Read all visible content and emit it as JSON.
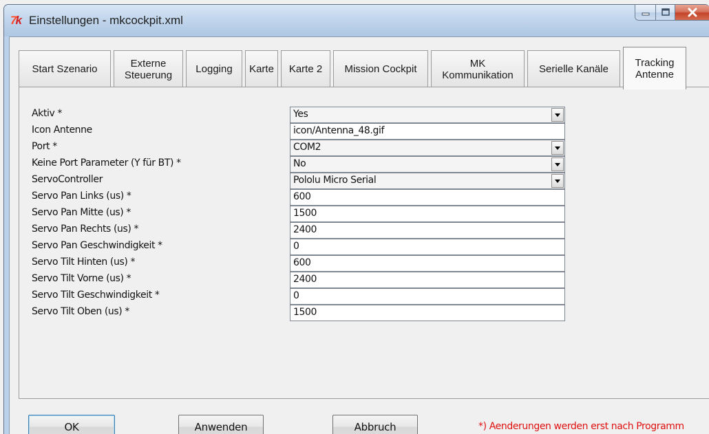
{
  "window": {
    "title": "Einstellungen - mkcockpit.xml",
    "icon": "mk-logo-icon",
    "caption_buttons": [
      "minimize-icon",
      "maximize-icon",
      "close-icon"
    ]
  },
  "tabs": [
    {
      "label": "Start Szenario",
      "active": false
    },
    {
      "label": "Externe\nSteuerung",
      "active": false
    },
    {
      "label": "Logging",
      "active": false
    },
    {
      "label": "Karte",
      "active": false
    },
    {
      "label": "Karte 2",
      "active": false
    },
    {
      "label": "Mission Cockpit",
      "active": false
    },
    {
      "label": "MK\nKommunikation",
      "active": false
    },
    {
      "label": "Serielle Kanäle",
      "active": false
    },
    {
      "label": "Tracking\nAntenne",
      "active": true
    }
  ],
  "settings": [
    {
      "label": "Aktiv *",
      "value": "Yes",
      "type": "combo"
    },
    {
      "label": "Icon Antenne",
      "value": "icon/Antenna_48.gif",
      "type": "text"
    },
    {
      "label": "Port *",
      "value": "COM2",
      "type": "combo"
    },
    {
      "label": "Keine Port Parameter (Y für BT) *",
      "value": "No",
      "type": "combo"
    },
    {
      "label": "ServoController",
      "value": "Pololu Micro Serial",
      "type": "combo"
    },
    {
      "label": "Servo Pan Links (us) *",
      "value": "600",
      "type": "text"
    },
    {
      "label": "Servo Pan Mitte (us) *",
      "value": "1500",
      "type": "text"
    },
    {
      "label": "Servo Pan Rechts (us) *",
      "value": "2400",
      "type": "text"
    },
    {
      "label": "Servo Pan Geschwindigkeit *",
      "value": "0",
      "type": "text"
    },
    {
      "label": "Servo Tilt Hinten (us) *",
      "value": "600",
      "type": "text"
    },
    {
      "label": "Servo Tilt Vorne (us) *",
      "value": "2400",
      "type": "text"
    },
    {
      "label": "Servo Tilt Geschwindigkeit *",
      "value": "0",
      "type": "text"
    },
    {
      "label": "Servo Tilt Oben (us) *",
      "value": "1500",
      "type": "text"
    }
  ],
  "buttons": {
    "ok": "OK",
    "apply": "Anwenden",
    "cancel": "Abbruch"
  },
  "footnote": "*) Aenderungen werden erst nach Programm",
  "colors": {
    "footnote": "#e01010",
    "titlebar": "#c2d6ec",
    "close_button": "#c4452a"
  }
}
